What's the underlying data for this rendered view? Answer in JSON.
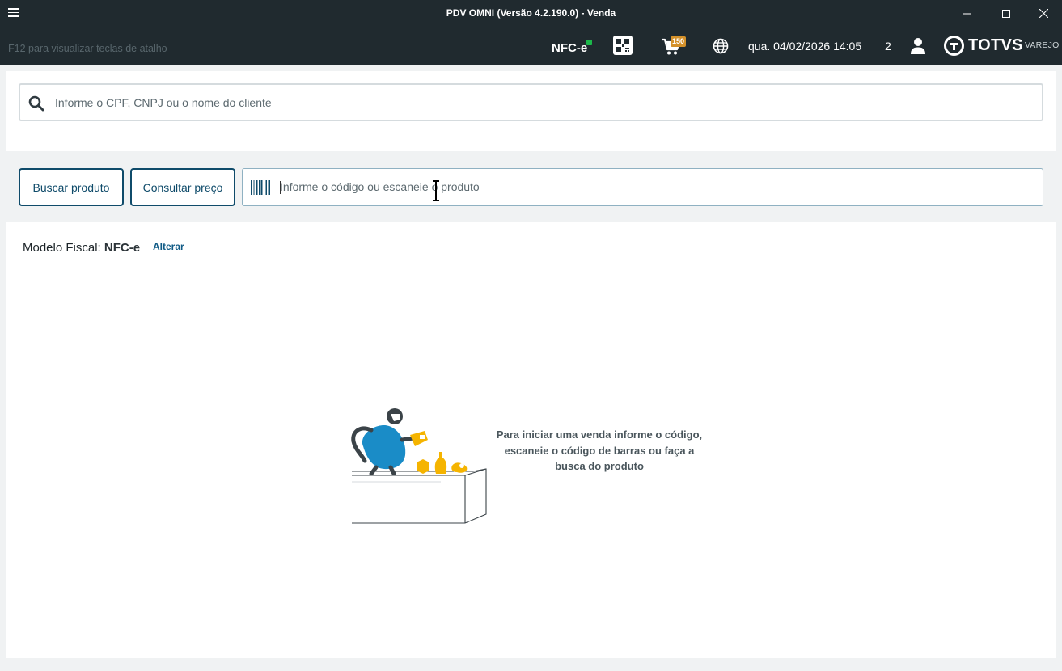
{
  "window": {
    "title": "PDV OMNI (Versão 4.2.190.0) - Venda",
    "menu_icon": "hamburger-menu-icon",
    "controls": [
      "minimize-icon",
      "maximize-icon",
      "close-icon"
    ]
  },
  "header": {
    "shortcut_hint": "F12 para visualizar teclas de atalho",
    "fiscal_status": "NFC-e",
    "fiscal_status_color": "#1bb84a",
    "cart_count": "150",
    "datetime": "qua. 04/02/2026 14:05",
    "counter": "2",
    "brand": "TOTVS",
    "brand_suffix": "VAREJO",
    "icons": [
      "qr-code-icon",
      "cart-icon",
      "globe-icon",
      "user-icon",
      "totvs-logo-icon"
    ]
  },
  "customer": {
    "search_placeholder": "Informe o CPF, CNPJ ou o nome do cliente",
    "search_value": ""
  },
  "product": {
    "search_button": "Buscar produto",
    "price_button": "Consultar preço",
    "input_placeholder": "Informe o código ou escaneie o produto",
    "input_value": ""
  },
  "main": {
    "fiscal_label": "Modelo Fiscal:",
    "fiscal_model": "NFC-e",
    "change_link": "Alterar",
    "empty_message": "Para iniciar uma venda informe o código, escaneie o código de barras ou faça a busca do produto"
  },
  "colors": {
    "titlebar_bg": "#202a2f",
    "accent": "#0f4b6a",
    "link": "#0f5a85",
    "illustration_yellow": "#f5b400",
    "illustration_blue": "#1a8cc7"
  }
}
